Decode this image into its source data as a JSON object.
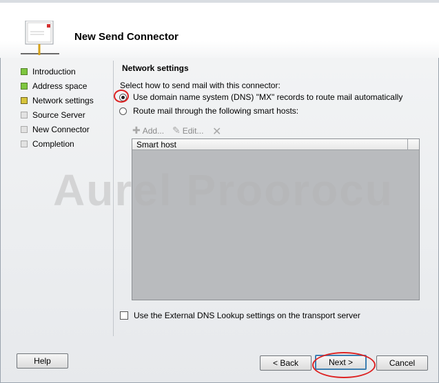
{
  "window": {
    "title": "New Send Connector"
  },
  "steps": [
    {
      "label": "Introduction",
      "state": "done"
    },
    {
      "label": "Address space",
      "state": "done"
    },
    {
      "label": "Network settings",
      "state": "current"
    },
    {
      "label": "Source Server",
      "state": "todo"
    },
    {
      "label": "New Connector",
      "state": "todo"
    },
    {
      "label": "Completion",
      "state": "todo"
    }
  ],
  "network": {
    "section_title": "Network settings",
    "prompt": "Select how to send mail with this connector:",
    "option_dns": "Use domain name system (DNS) \"MX\" records to route mail automatically",
    "option_smarthost": "Route mail through the following smart hosts:",
    "selected": "dns"
  },
  "toolbar": {
    "add_label": "Add...",
    "edit_label": "Edit...",
    "add_icon": "plus-icon",
    "edit_icon": "pencil-icon",
    "remove_icon": "x-icon"
  },
  "grid": {
    "column": "Smart host",
    "rows": []
  },
  "external_dns_label": "Use the External DNS Lookup settings on the transport server",
  "external_dns_checked": false,
  "watermark": "Aurel Proorocu",
  "buttons": {
    "help": "Help",
    "back": "< Back",
    "next": "Next >",
    "cancel": "Cancel"
  },
  "colors": {
    "step_done": "#7ec63f",
    "step_current": "#d7c43b",
    "annotation": "#dd2222"
  }
}
